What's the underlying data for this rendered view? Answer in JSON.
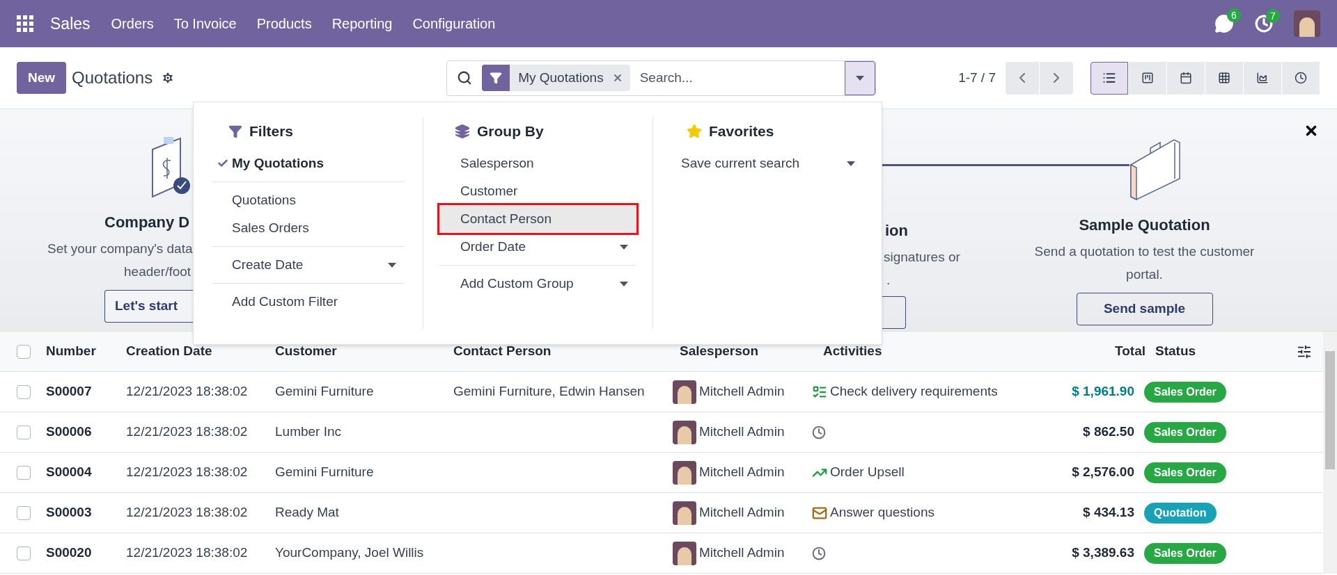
{
  "navbar": {
    "app": "Sales",
    "menu": [
      "Orders",
      "To Invoice",
      "Products",
      "Reporting",
      "Configuration"
    ],
    "messages_badge": "6",
    "activities_badge": "7"
  },
  "control_panel": {
    "new_button": "New",
    "title": "Quotations",
    "search": {
      "facet": "My Quotations",
      "placeholder": "Search...",
      "dropdown_open": true
    },
    "pager": "1-7 / 7",
    "views": [
      {
        "kind": "list",
        "selected": true
      },
      {
        "kind": "kanban",
        "selected": false
      },
      {
        "kind": "calendar",
        "selected": false
      },
      {
        "kind": "pivot",
        "selected": false
      },
      {
        "kind": "graph",
        "selected": false
      },
      {
        "kind": "activity",
        "selected": false
      }
    ]
  },
  "banner": {
    "left": {
      "title": "Company D",
      "lines": [
        "Set your company's data",
        "header/foot"
      ],
      "button": "Let's start"
    },
    "middle": {
      "title": "ion",
      "lines": [
        "signatures or",
        "."
      ]
    },
    "right": {
      "title": "Sample Quotation",
      "lines": [
        "Send a quotation to test the customer",
        "portal."
      ],
      "button": "Send sample"
    }
  },
  "search_panel": {
    "filters": {
      "title": "Filters",
      "groups": [
        [
          {
            "label": "My Quotations",
            "checked": true,
            "kind": "option"
          }
        ],
        [
          {
            "label": "Quotations",
            "checked": false,
            "kind": "option"
          },
          {
            "label": "Sales Orders",
            "checked": false,
            "kind": "option"
          }
        ],
        [
          {
            "label": "Create Date",
            "checked": false,
            "kind": "submenu"
          }
        ],
        [
          {
            "label": "Add Custom Filter",
            "checked": false,
            "kind": "option"
          }
        ]
      ]
    },
    "group_by": {
      "title": "Group By",
      "groups": [
        [
          {
            "label": "Salesperson",
            "highlighted": false,
            "kind": "option"
          },
          {
            "label": "Customer",
            "highlighted": false,
            "kind": "option"
          },
          {
            "label": "Contact Person",
            "highlighted": true,
            "kind": "option"
          },
          {
            "label": "Order Date",
            "highlighted": false,
            "kind": "submenu"
          }
        ],
        [
          {
            "label": "Add Custom Group",
            "highlighted": false,
            "kind": "submenu"
          }
        ]
      ]
    },
    "favorites": {
      "title": "Favorites",
      "items": [
        {
          "label": "Save current search",
          "kind": "submenu"
        }
      ]
    }
  },
  "table": {
    "select_all_checked": false,
    "columns": [
      "Number",
      "Creation Date",
      "Customer",
      "Contact Person",
      "Salesperson",
      "Activities",
      "Total",
      "Status"
    ],
    "rows": [
      {
        "checked": false,
        "number": "S00007",
        "date": "12/21/2023 18:38:02",
        "customer": "Gemini Furniture",
        "contact": "Gemini Furniture, Edwin Hansen",
        "salesperson": "Mitchell Admin",
        "activity": {
          "kind": "todo",
          "label": "Check delivery requirements"
        },
        "total": "$ 1,961.90",
        "total_highlighted": true,
        "status": {
          "label": "Sales Order",
          "color": "#28a745"
        }
      },
      {
        "checked": false,
        "number": "S00006",
        "date": "12/21/2023 18:38:02",
        "customer": "Lumber Inc",
        "contact": "",
        "salesperson": "Mitchell Admin",
        "activity": {
          "kind": "none"
        },
        "total": "$ 862.50",
        "total_highlighted": false,
        "status": {
          "label": "Sales Order",
          "color": "#28a745"
        }
      },
      {
        "checked": false,
        "number": "S00004",
        "date": "12/21/2023 18:38:02",
        "customer": "Gemini Furniture",
        "contact": "",
        "salesperson": "Mitchell Admin",
        "activity": {
          "kind": "upsell",
          "label": "Order Upsell"
        },
        "total": "$ 2,576.00",
        "total_highlighted": false,
        "status": {
          "label": "Sales Order",
          "color": "#28a745"
        }
      },
      {
        "checked": false,
        "number": "S00003",
        "date": "12/21/2023 18:38:02",
        "customer": "Ready Mat",
        "contact": "",
        "salesperson": "Mitchell Admin",
        "activity": {
          "kind": "email",
          "label": "Answer questions"
        },
        "total": "$ 434.13",
        "total_highlighted": false,
        "status": {
          "label": "Quotation",
          "color": "#17a2b8"
        }
      },
      {
        "checked": false,
        "number": "S00020",
        "date": "12/21/2023 18:38:02",
        "customer": "YourCompany, Joel Willis",
        "contact": "",
        "salesperson": "Mitchell Admin",
        "activity": {
          "kind": "none"
        },
        "total": "$ 3,389.63",
        "total_highlighted": false,
        "status": {
          "label": "Sales Order",
          "color": "#28a745"
        }
      }
    ]
  }
}
